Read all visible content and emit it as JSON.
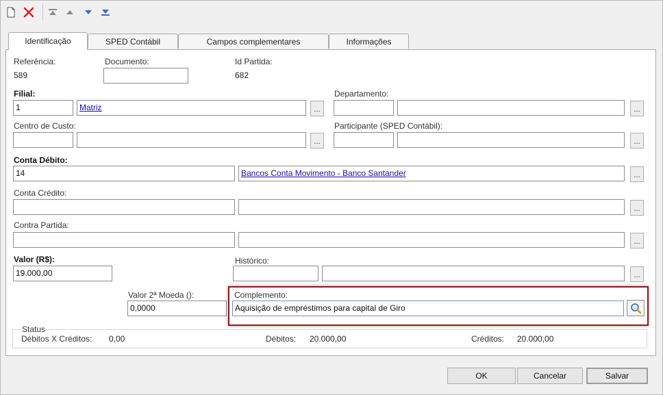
{
  "toolbar": {
    "icons": [
      "new-document-icon",
      "delete-icon",
      "first-record-icon",
      "previous-record-icon",
      "next-record-icon",
      "last-record-icon"
    ]
  },
  "tabs": [
    {
      "label": "Identificação",
      "active": true
    },
    {
      "label": "SPED Contábil",
      "active": false
    },
    {
      "label": "Campos complementares",
      "active": false
    },
    {
      "label": "Informações",
      "active": false
    }
  ],
  "form": {
    "referencia": {
      "label": "Referência:",
      "value": "589"
    },
    "documento": {
      "label": "Documento:",
      "value": ""
    },
    "id_partida": {
      "label": "Id Partida:",
      "value": "682"
    },
    "filial": {
      "label": "Filial:",
      "code": "1",
      "name": "Matriz"
    },
    "departamento": {
      "label": "Departamento:",
      "code": "",
      "name": ""
    },
    "centro_custo": {
      "label": "Centro de Custo:",
      "code": "",
      "name": ""
    },
    "participante": {
      "label": "Participante (SPED Contábil):",
      "code": "",
      "name": ""
    },
    "conta_debito": {
      "label": "Conta Débito:",
      "code": "14",
      "name": "Bancos Conta Movimento - Banco Santander"
    },
    "conta_credito": {
      "label": "Conta Crédito:",
      "code": "",
      "name": ""
    },
    "contra_partida": {
      "label": "Contra Partida:",
      "code": "",
      "name": ""
    },
    "valor": {
      "label": "Valor (R$):",
      "value": "19.000,00"
    },
    "historico": {
      "label": "Histórico:",
      "code": "",
      "name": ""
    },
    "valor_moeda2": {
      "label": "Valor 2ª Moeda ():",
      "value": "0,0000"
    },
    "complemento": {
      "label": "Complemento:",
      "value": "Aquisição de empréstimos para capital de Giro"
    },
    "ellipsis": "..."
  },
  "status": {
    "title": "Status",
    "debitos_x_creditos_label": "Débitos X Créditos:",
    "debitos_x_creditos_value": "0,00",
    "debitos_label": "Débitos:",
    "debitos_value": "20.000,00",
    "creditos_label": "Créditos:",
    "creditos_value": "20.000,00"
  },
  "buttons": {
    "ok": "OK",
    "cancel": "Cancelar",
    "save": "Salvar"
  },
  "colors": {
    "accent_highlight": "#8b1a1a",
    "link": "#1a0dab",
    "delete": "#e02020",
    "nav_arrows": "#2f6fd6"
  }
}
